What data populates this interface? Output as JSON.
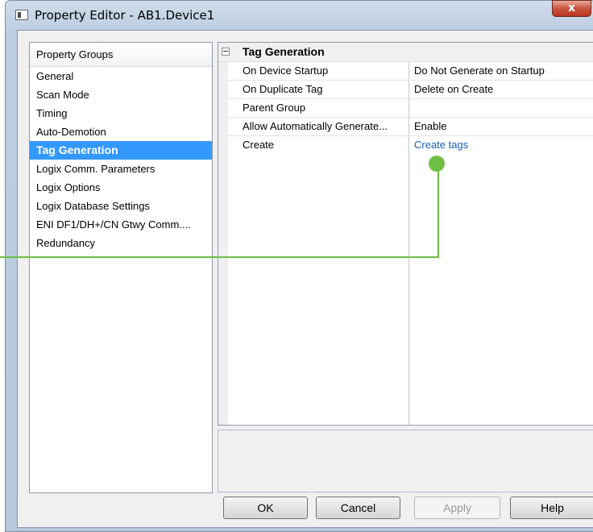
{
  "window": {
    "title": "Property Editor - AB1.Device1",
    "close_glyph": "x"
  },
  "groups": {
    "header": "Property Groups",
    "items": [
      {
        "label": "General"
      },
      {
        "label": "Scan Mode"
      },
      {
        "label": "Timing"
      },
      {
        "label": "Auto-Demotion"
      },
      {
        "label": "Tag Generation",
        "selected": true
      },
      {
        "label": "Logix Comm. Parameters"
      },
      {
        "label": "Logix Options"
      },
      {
        "label": "Logix Database Settings"
      },
      {
        "label": "ENI DF1/DH+/CN Gtwy Comm...."
      },
      {
        "label": "Redundancy"
      }
    ]
  },
  "grid": {
    "category": "Tag Generation",
    "rows": [
      {
        "name": "On Device Startup",
        "value": "Do Not Generate on Startup"
      },
      {
        "name": "On Duplicate Tag",
        "value": "Delete on Create"
      },
      {
        "name": "Parent Group",
        "value": ""
      },
      {
        "name": "Allow Automatically Generate...",
        "value": "Enable"
      },
      {
        "name": "Create",
        "value": "Create tags"
      }
    ]
  },
  "buttons": {
    "ok": "OK",
    "cancel": "Cancel",
    "apply": "Apply",
    "help": "Help"
  },
  "colors": {
    "selection": "#3399ff",
    "link": "#1a5fb4",
    "callout": "#6fbe44"
  }
}
